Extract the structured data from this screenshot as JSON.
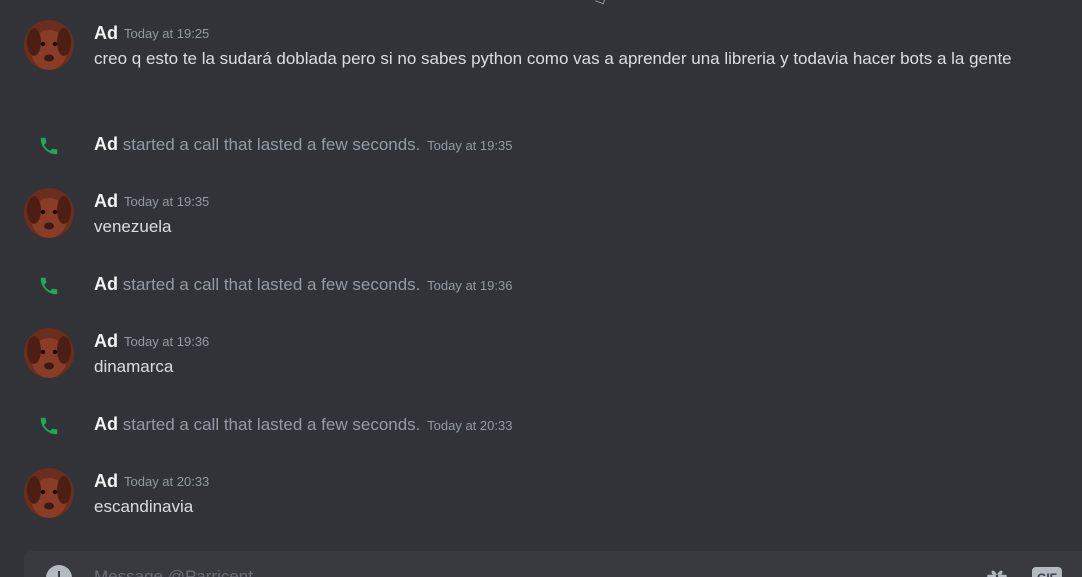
{
  "colors": {
    "background": "#313338",
    "author": "#f2f3f5",
    "text": "#dbdee1",
    "muted": "#949ba4",
    "call_green": "#23a55a",
    "composer": "#383a40"
  },
  "messages": [
    {
      "author": "Ad",
      "timestamp": "Today at 19:25",
      "content": "creo q esto te la sudará doblada pero si no sabes python como vas a aprender una libreria y todavia hacer bots a la gente"
    },
    {
      "author": "Ad",
      "timestamp": "Today at 19:35",
      "content": "venezuela"
    },
    {
      "author": "Ad",
      "timestamp": "Today at 19:36",
      "content": "dinamarca"
    },
    {
      "author": "Ad",
      "timestamp": "Today at 20:33",
      "content": "escandinavia"
    }
  ],
  "calls": [
    {
      "author": "Ad",
      "text": "started a call that lasted a few seconds.",
      "timestamp": "Today at 19:35",
      "icon": "phone-icon"
    },
    {
      "author": "Ad",
      "text": "started a call that lasted a few seconds.",
      "timestamp": "Today at 19:36",
      "icon": "phone-icon"
    },
    {
      "author": "Ad",
      "text": "started a call that lasted a few seconds.",
      "timestamp": "Today at 20:33",
      "icon": "phone-icon"
    }
  ],
  "composer": {
    "placeholder": "Message @Parricent",
    "gif_label": "GIF",
    "icons": [
      "add-attachment-icon",
      "gift-icon"
    ]
  }
}
